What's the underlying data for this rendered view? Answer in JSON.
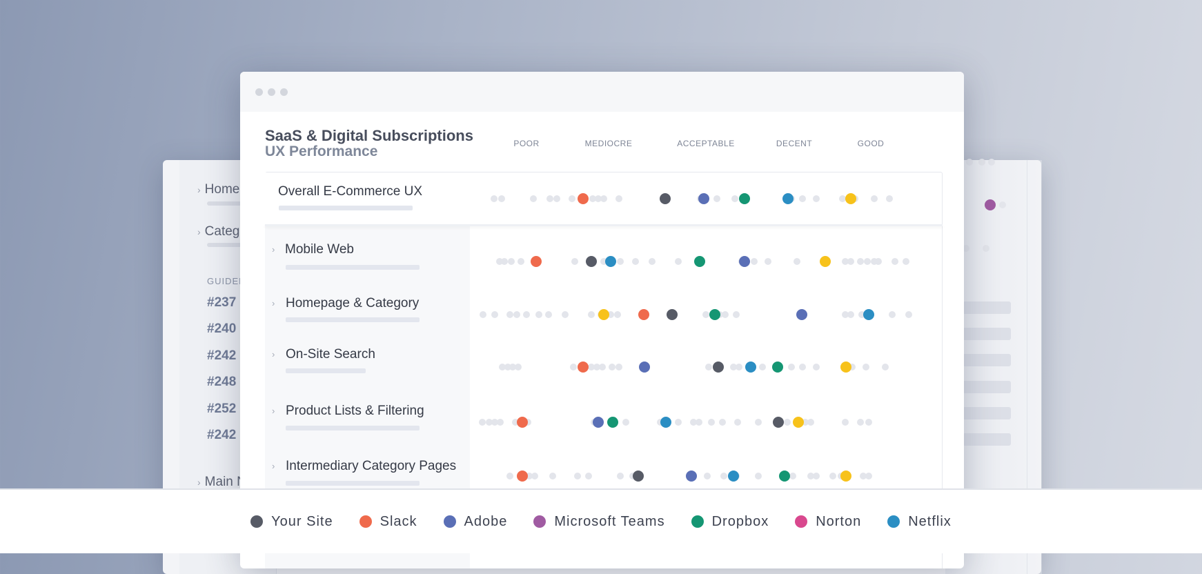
{
  "background_window": {
    "nav": [
      "Home",
      "Categ"
    ],
    "guidelines_label": "GUIDEL",
    "links": [
      "#237",
      "#240",
      "#242",
      "#248",
      "#252",
      "#242"
    ],
    "bottom_item": "Main N"
  },
  "header": {
    "title": "SaaS & Digital Subscriptions",
    "subtitle": "UX Performance"
  },
  "scale": [
    "POOR",
    "MEDIOCRE",
    "ACCEPTABLE",
    "DECENT",
    "GOOD"
  ],
  "rows": [
    {
      "label": "Overall E-Commerce UX"
    },
    {
      "label": "Mobile Web"
    },
    {
      "label": "Homepage & Category"
    },
    {
      "label": "On-Site Search"
    },
    {
      "label": "Product Lists & Filtering"
    },
    {
      "label": "Intermediary Category Pages"
    }
  ],
  "legend": [
    {
      "label": "Your Site",
      "color": "#575b66"
    },
    {
      "label": "Slack",
      "color": "#ef6a4c"
    },
    {
      "label": "Adobe",
      "color": "#5a6fb6"
    },
    {
      "label": "Microsoft Teams",
      "color": "#a05ba2"
    },
    {
      "label": "Dropbox",
      "color": "#159673"
    },
    {
      "label": "Norton",
      "color": "#d9488e"
    },
    {
      "label": "Netflix",
      "color": "#2b8ec3"
    }
  ],
  "colors": {
    "your_site": "#575b66",
    "slack": "#ef6a4c",
    "adobe": "#5a6fb6",
    "microsoft_teams": "#a05ba2",
    "dropbox": "#159673",
    "norton": "#d9488e",
    "netflix": "#2b8ec3",
    "other": "#f7c21b"
  }
}
